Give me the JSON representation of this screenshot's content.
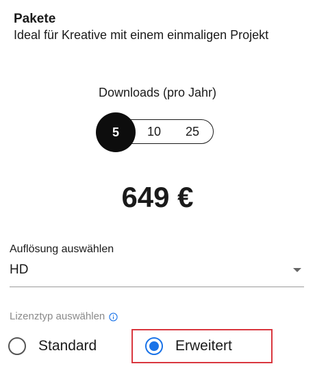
{
  "header": {
    "title": "Pakete",
    "subtitle": "Ideal für Kreative mit einem einmaligen Projekt"
  },
  "downloads": {
    "label": "Downloads (pro Jahr)",
    "options": [
      "5",
      "10",
      "25"
    ],
    "selected": "5"
  },
  "price": {
    "amount": "649 €"
  },
  "resolution": {
    "label": "Auflösung auswählen",
    "value": "HD"
  },
  "license": {
    "label": "Lizenztyp auswählen",
    "options": [
      "Standard",
      "Erweitert"
    ],
    "selected": "Erweitert",
    "info_icon": "info-icon"
  },
  "colors": {
    "accent": "#1a73e8",
    "highlight_border": "#d9363e",
    "selected_segment": "#0d0d0d"
  }
}
